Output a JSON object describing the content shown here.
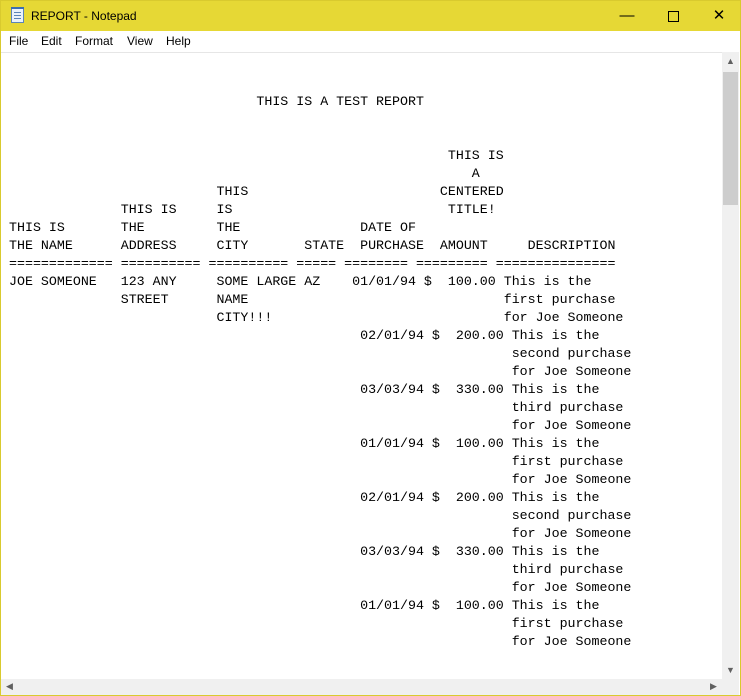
{
  "window": {
    "title": "REPORT - Notepad",
    "icon": "notepad-icon",
    "controls": {
      "minimize": "—",
      "close": "✕"
    }
  },
  "menu": {
    "items": [
      "File",
      "Edit",
      "Format",
      "View",
      "Help"
    ]
  },
  "report": {
    "lines": [
      "",
      "",
      "                               THIS IS A TEST REPORT",
      "",
      "",
      "                                                       THIS IS",
      "                                                          A",
      "                          THIS                        CENTERED",
      "              THIS IS     IS                           TITLE!",
      "THIS IS       THE         THE               DATE OF",
      "THE NAME      ADDRESS     CITY       STATE  PURCHASE  AMOUNT     DESCRIPTION",
      "============= ========== ========== ===== ======== ========= ===============",
      "JOE SOMEONE   123 ANY     SOME LARGE AZ    01/01/94 $  100.00 This is the",
      "              STREET      NAME                                first purchase",
      "                          CITY!!!                             for Joe Someone",
      "                                            02/01/94 $  200.00 This is the",
      "                                                               second purchase",
      "                                                               for Joe Someone",
      "                                            03/03/94 $  330.00 This is the",
      "                                                               third purchase",
      "                                                               for Joe Someone",
      "                                            01/01/94 $  100.00 This is the",
      "                                                               first purchase",
      "                                                               for Joe Someone",
      "                                            02/01/94 $  200.00 This is the",
      "                                                               second purchase",
      "                                                               for Joe Someone",
      "                                            03/03/94 $  330.00 This is the",
      "                                                               third purchase",
      "                                                               for Joe Someone",
      "                                            01/01/94 $  100.00 This is the",
      "                                                               first purchase",
      "                                                               for Joe Someone"
    ]
  },
  "scrollbars": {
    "up": "▲",
    "down": "▼",
    "left": "◀",
    "right": "▶"
  },
  "colors": {
    "titlebar": "#e6d835",
    "border": "#d9ca2e",
    "scroll_thumb": "#cdcdcd"
  }
}
